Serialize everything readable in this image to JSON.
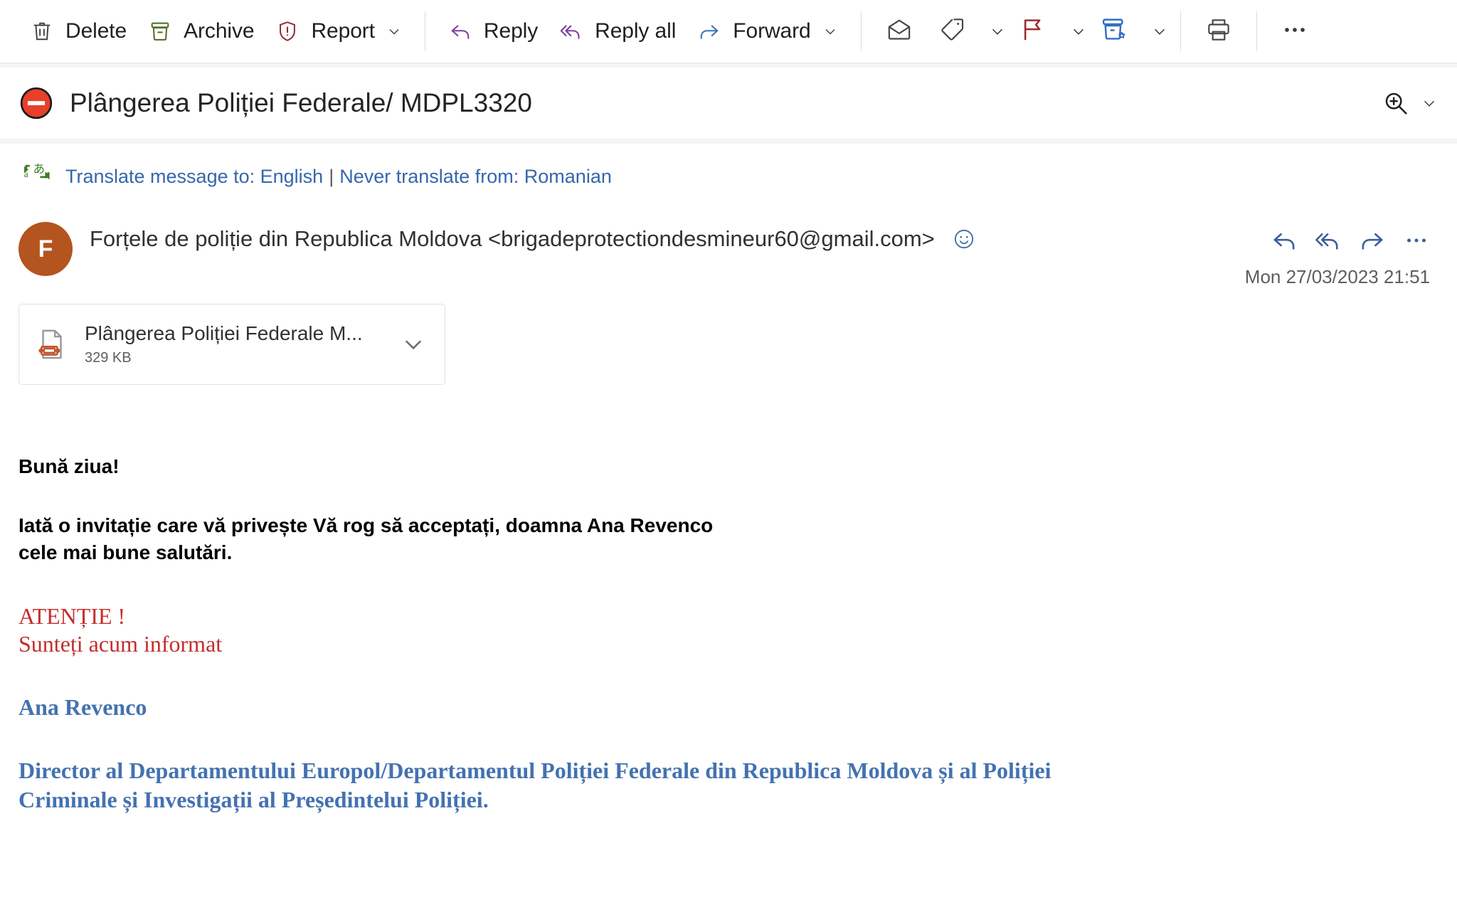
{
  "toolbar": {
    "buttons": [
      {
        "label": "Delete",
        "icon": "trash-icon",
        "caret": false
      },
      {
        "label": "Archive",
        "icon": "archive-icon",
        "caret": false
      },
      {
        "label": "Report",
        "icon": "report-shield-icon",
        "caret": true
      },
      {
        "label": "Reply",
        "icon": "reply-arrow-icon",
        "caret": false
      },
      {
        "label": "Reply all",
        "icon": "reply-all-arrow-icon",
        "caret": false
      },
      {
        "label": "Forward",
        "icon": "forward-arrow-icon",
        "caret": true
      }
    ],
    "icon_buttons": [
      {
        "name": "mark-unread-envelope-icon",
        "caret": false
      },
      {
        "name": "tag-icon",
        "caret": true
      },
      {
        "name": "flag-icon",
        "caret": true
      },
      {
        "name": "sweep-rules-icon",
        "caret": true
      },
      {
        "name": "print-icon",
        "caret": false
      },
      {
        "name": "more-options-icon",
        "caret": false
      }
    ]
  },
  "subject": {
    "text": "Plângerea Poliției Federale/ MDPL3320",
    "status_icon": "blocked-sender-icon",
    "zoom_icon": "zoom-in-icon",
    "zoom_caret_icon": "chevron-down-icon"
  },
  "translate": {
    "icon": "translate-icon",
    "translate_link": "Translate message to: English",
    "separator": "|",
    "never_link": "Never translate from: Romanian"
  },
  "sender": {
    "avatar_initial": "F",
    "avatar_color": "#b4541f",
    "name_and_address": "Forțele de poliție din Republica Moldova <brigadeprotectiondesmineur60@gmail.com>",
    "smiley_icon": "smiley-reaction-icon",
    "timestamp": "Mon 27/03/2023 21:51",
    "actions": [
      {
        "name": "reply-arrow-icon"
      },
      {
        "name": "reply-all-arrow-icon"
      },
      {
        "name": "forward-arrow-icon"
      },
      {
        "name": "more-actions-icon"
      }
    ]
  },
  "attachment": {
    "icon": "document-attachment-icon",
    "name": "Plângerea Poliției Federale M...",
    "size": "329 KB",
    "caret_icon": "chevron-down-icon"
  },
  "body": {
    "greeting": "Bună ziua!",
    "para1_line1": "Iată o invitație care vă privește Vă rog să acceptați, doamna Ana Revenco",
    "para1_line2": "cele mai bune salutări.",
    "warning_line1": "ATENȚIE !",
    "warning_line2": "Sunteți acum informat",
    "signature_name": "Ana Revenco",
    "signature_title_line1": "Director al Departamentului Europol/Departamentul Poliției Federale din Republica Moldova și al Poliției",
    "signature_title_line2": "Criminale și Investigații al Președintelui Poliției."
  },
  "colors": {
    "accent_blue": "#3567ab",
    "warning_red": "#c32f2c",
    "signature_blue": "#4472b0",
    "archive_green": "#4f6b1e",
    "report_red": "#8e2a32"
  }
}
